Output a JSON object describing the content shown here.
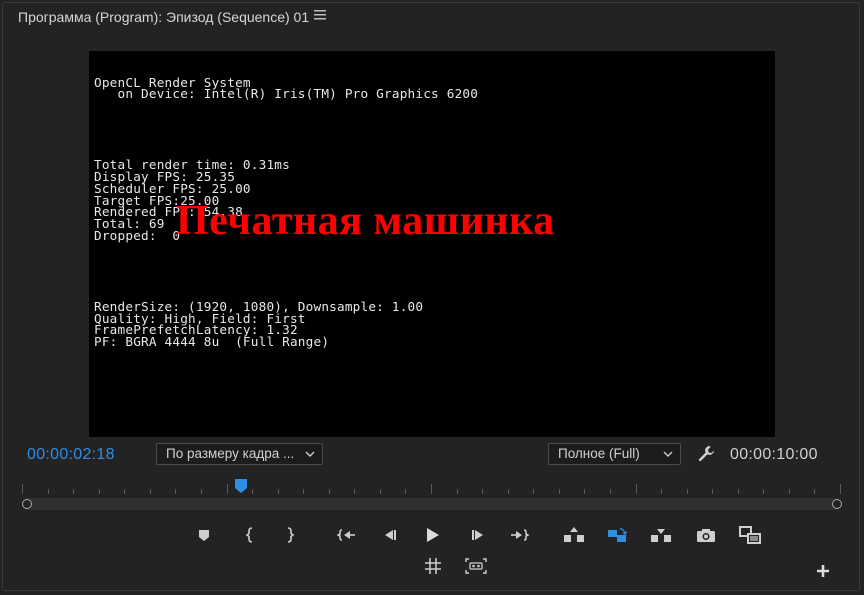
{
  "panel": {
    "title": "Программа (Program): Эпизод (Sequence) 01",
    "menu_icon": "hamburger-menu-icon"
  },
  "viewer": {
    "overlay_lines_a": [
      "OpenCL Render System",
      "   on Device: Intel(R) Iris(TM) Pro Graphics 6200"
    ],
    "overlay_lines_b": [
      "Total render time: 0.31ms",
      "Display FPS: 25.35",
      "Scheduler FPS: 25.00",
      "Target FPS:25.00",
      "Rendered FPS: 54.38",
      "Total: 69",
      "Dropped:  0"
    ],
    "overlay_lines_c": [
      "RenderSize: (1920, 1080), Downsample: 1.00",
      "Quality: High, Field: First",
      "FramePrefetchLatency: 1.32",
      "PF: BGRA 4444 8u  (Full Range)"
    ],
    "title_text": "Печатная машинка",
    "title_color": "#ff0000"
  },
  "controls": {
    "current_timecode": "00:00:02:18",
    "duration_timecode": "00:00:10:00",
    "zoom_select": "По размеру кадра ...",
    "resolution_select": "Полное (Full)",
    "accent_color": "#2e8fe5",
    "playhead_fraction": 0.268
  },
  "transport_buttons": [
    {
      "name": "add-marker-button",
      "icon": "marker-icon"
    },
    {
      "name": "mark-in-button",
      "icon": "mark-in-icon"
    },
    {
      "name": "mark-out-button",
      "icon": "mark-out-icon"
    },
    {
      "name": "go-to-in-button",
      "icon": "go-to-in-icon"
    },
    {
      "name": "step-back-button",
      "icon": "step-back-icon"
    },
    {
      "name": "play-button",
      "icon": "play-icon"
    },
    {
      "name": "step-forward-button",
      "icon": "step-forward-icon"
    },
    {
      "name": "go-to-out-button",
      "icon": "go-to-out-icon"
    },
    {
      "name": "lift-button",
      "icon": "lift-icon"
    },
    {
      "name": "extract-button",
      "icon": "extract-icon"
    },
    {
      "name": "export-frame-button",
      "icon": "camera-icon"
    },
    {
      "name": "comparison-view-button",
      "icon": "comparison-view-icon"
    },
    {
      "name": "safe-margins-button",
      "icon": "grid-icon"
    },
    {
      "name": "vr-video-button",
      "icon": "vr-icon"
    },
    {
      "name": "button-editor-button",
      "icon": "plus-icon"
    }
  ]
}
